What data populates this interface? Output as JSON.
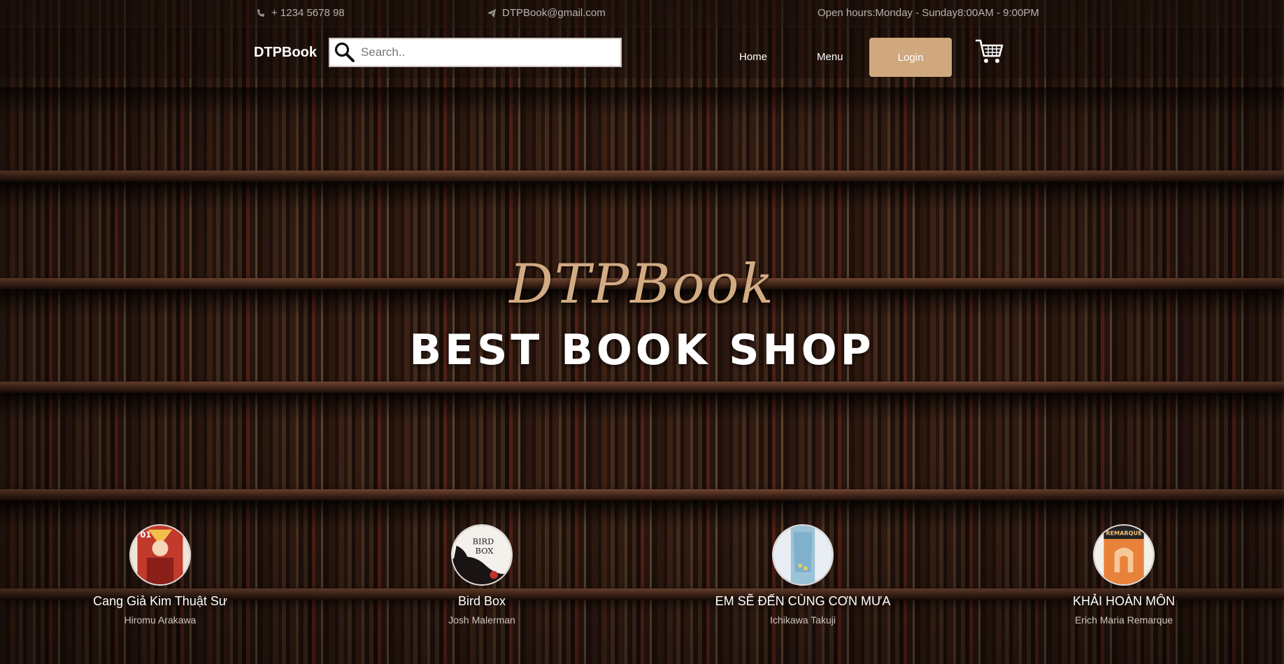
{
  "topbar": {
    "phone": "+ 1234 5678 98",
    "email": "DTPBook@gmail.com",
    "hours": "Open hours:Monday - Sunday8:00AM - 9:00PM"
  },
  "nav": {
    "brand": "DTPBook",
    "search_placeholder": "Search..",
    "links": [
      "Home",
      "Menu"
    ],
    "login_label": "Login"
  },
  "hero": {
    "script_title": "DTPBook",
    "headline": "BEST BOOK SHOP"
  },
  "featured_books": [
    {
      "title": "Cang Giả Kim Thuật Sư",
      "author": "Hiromu Arakawa",
      "cover_color": "#c23a2c"
    },
    {
      "title": "Bird Box",
      "author": "Josh Malerman",
      "cover_color": "#1a1414"
    },
    {
      "title": "EM SẼ ĐẾN CÙNG CƠN MƯA",
      "author": "Ichikawa Takuji",
      "cover_color": "#9cc2d8"
    },
    {
      "title": "KHẢI HOÀN MÔN",
      "author": "Erich Maria Remarque",
      "cover_color": "#e8823a"
    }
  ],
  "colors": {
    "accent": "#cfa87e",
    "script_gold": "#d2ab83"
  }
}
